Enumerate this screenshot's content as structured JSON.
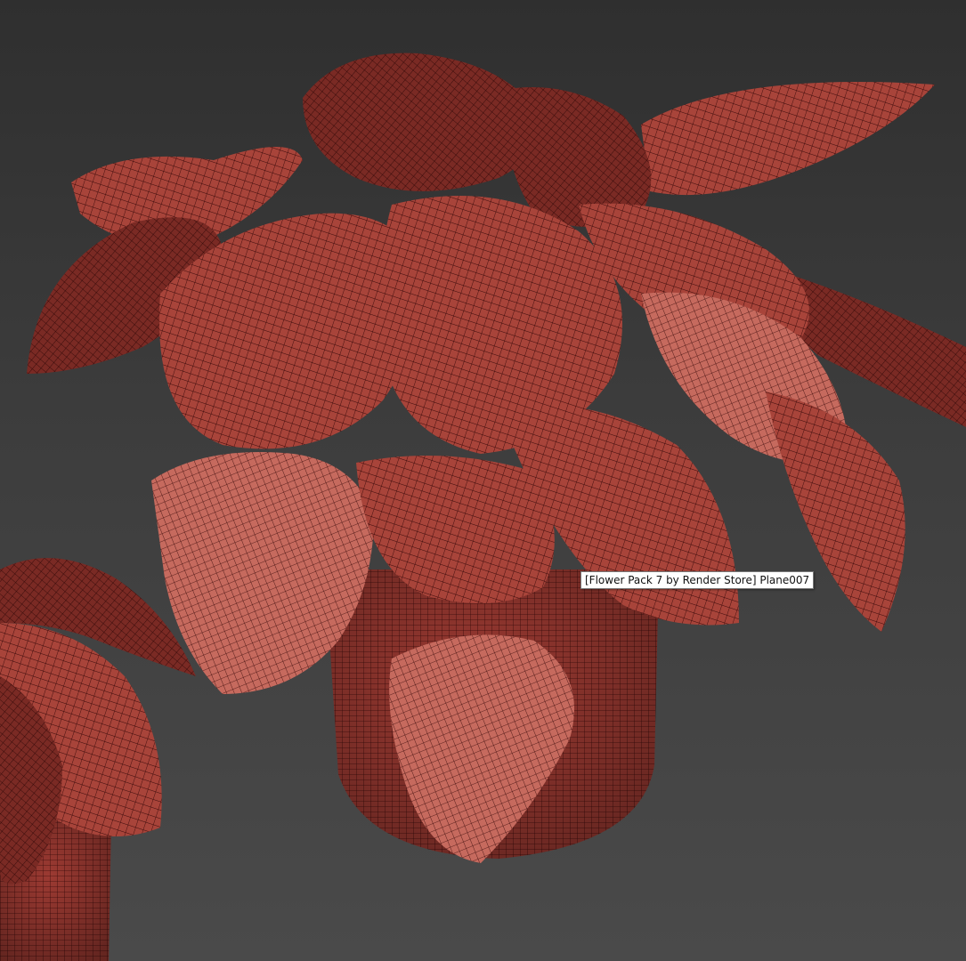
{
  "viewport": {
    "background_top": "#2f2f2f",
    "background_bottom": "#4a4a4a"
  },
  "model": {
    "wire_color": "#3a0a0a",
    "shade_dark": "#7a2a24",
    "shade_mid": "#a8443a",
    "shade_light": "#c96a5e"
  },
  "tooltip": {
    "text": "[Flower Pack 7 by Render Store] Plane007"
  }
}
